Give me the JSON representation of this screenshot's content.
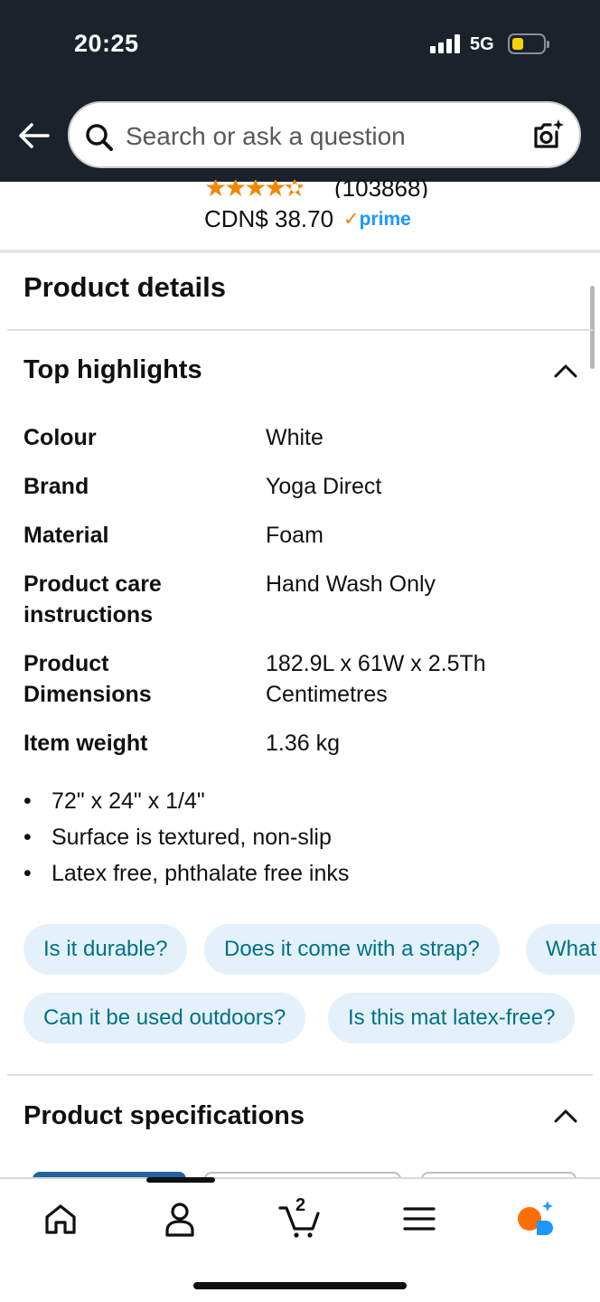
{
  "status_bar": {
    "time": "20:25",
    "network": "5G"
  },
  "search": {
    "placeholder": "Search or ask a question"
  },
  "product": {
    "rating_stars": "★★★★✫",
    "review_count": "(103868)",
    "price": "CDN$ 38.70",
    "prime_check": "✓",
    "prime_label": "prime"
  },
  "product_details": {
    "title": "Product details",
    "top_highlights": {
      "title": "Top highlights",
      "rows": [
        {
          "label": "Colour",
          "value": "White"
        },
        {
          "label": "Brand",
          "value": "Yoga Direct"
        },
        {
          "label": "Material",
          "value": "Foam"
        },
        {
          "label": "Product care instructions",
          "value": "Hand Wash Only"
        },
        {
          "label": "Product Dimensions",
          "value": "182.9L x 61W x 2.5Th Centimetres"
        },
        {
          "label": "Item weight",
          "value": "1.36 kg"
        }
      ],
      "bullets": [
        "72\" x 24\" x 1/4\"",
        "Surface is textured, non-slip",
        "Latex free, phthalate free inks"
      ]
    },
    "questions": [
      "Is it durable?",
      "Does it come with a strap?",
      "What",
      "Can it be used outdoors?",
      "Is this mat latex-free?"
    ],
    "specifications": {
      "title": "Product specifications"
    }
  },
  "bottom_nav": {
    "cart_count": "2"
  },
  "colors": {
    "header_bg": "#1b222c",
    "chip_bg": "#e4f1fb",
    "chip_text": "#007185",
    "star": "#f08804",
    "prime": "#1a98ff",
    "rufus_orange": "#ff6f00",
    "rufus_blue": "#1a98ff"
  }
}
